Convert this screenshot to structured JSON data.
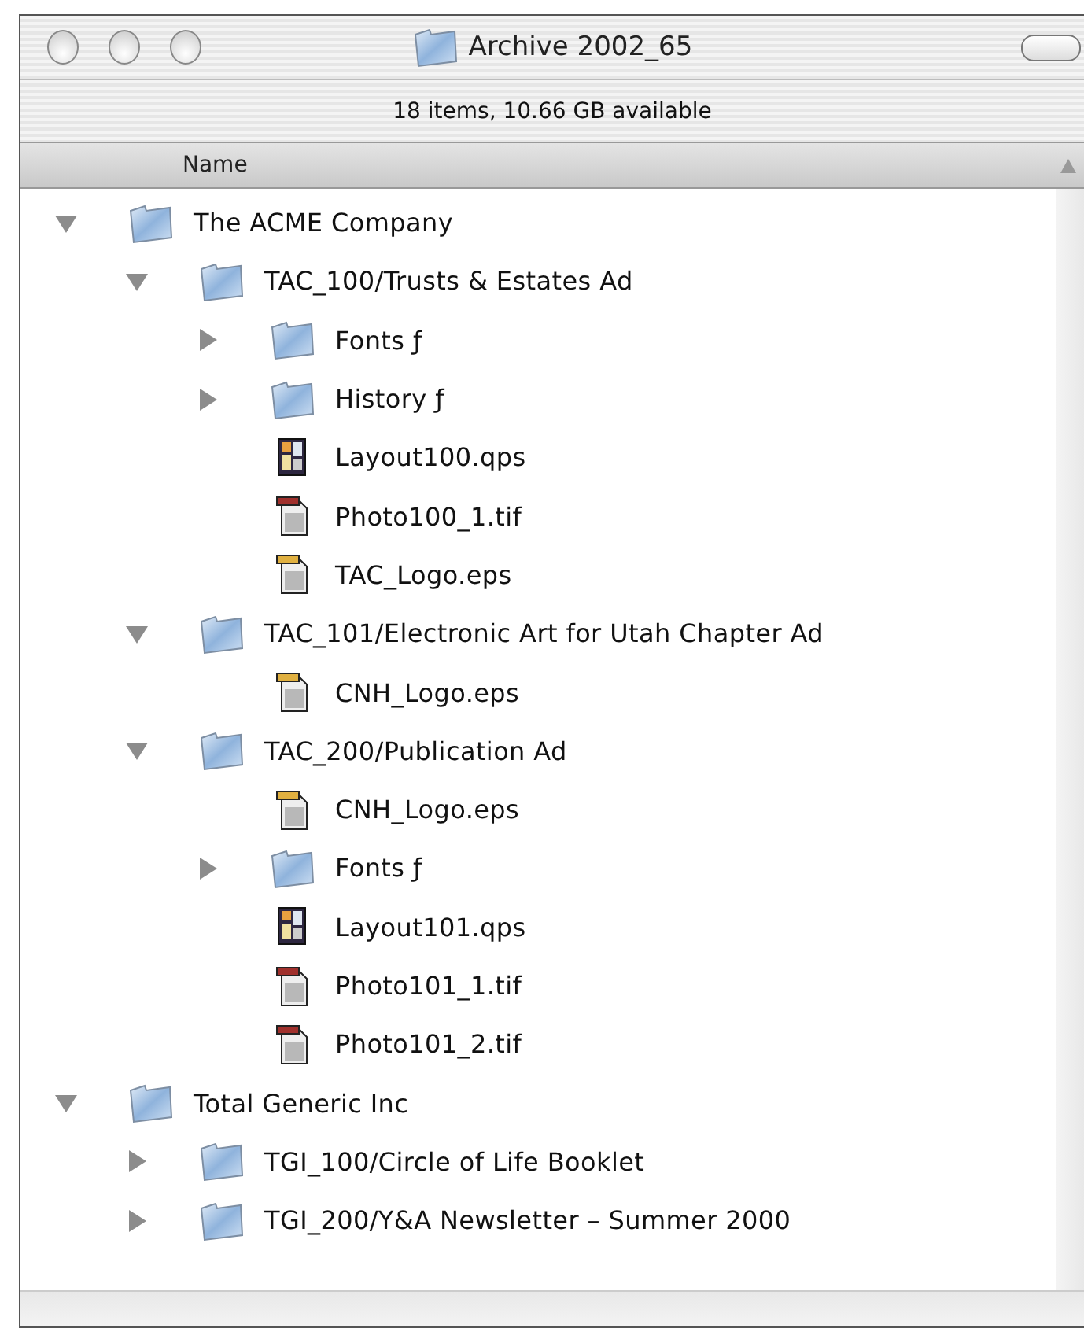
{
  "window": {
    "title": "Archive 2002_65",
    "status": "18 items, 10.66 GB available"
  },
  "columns": [
    {
      "label": "Name",
      "sorted": true
    }
  ],
  "items": [
    {
      "kind": "folder",
      "name": "The ACME Company",
      "expanded": true,
      "children": [
        {
          "kind": "folder",
          "name": "TAC_100/Trusts & Estates Ad",
          "expanded": true,
          "children": [
            {
              "kind": "folder",
              "name": "Fonts ƒ",
              "expanded": false
            },
            {
              "kind": "folder",
              "name": "History ƒ",
              "expanded": false
            },
            {
              "kind": "layout",
              "name": "Layout100.qps"
            },
            {
              "kind": "photo",
              "name": "Photo100_1.tif"
            },
            {
              "kind": "graphic",
              "name": "TAC_Logo.eps"
            }
          ]
        },
        {
          "kind": "folder",
          "name": "TAC_101/Electronic Art for Utah Chapter Ad",
          "expanded": true,
          "children": [
            {
              "kind": "graphic",
              "name": "CNH_Logo.eps"
            }
          ]
        },
        {
          "kind": "folder",
          "name": "TAC_200/Publication Ad",
          "expanded": true,
          "children": [
            {
              "kind": "graphic",
              "name": "CNH_Logo.eps"
            },
            {
              "kind": "folder",
              "name": "Fonts ƒ",
              "expanded": false
            },
            {
              "kind": "layout",
              "name": "Layout101.qps"
            },
            {
              "kind": "photo",
              "name": "Photo101_1.tif"
            },
            {
              "kind": "photo",
              "name": "Photo101_2.tif"
            }
          ]
        }
      ]
    },
    {
      "kind": "folder",
      "name": "Total Generic Inc",
      "expanded": true,
      "children": [
        {
          "kind": "folder",
          "name": "TGI_100/Circle of Life Booklet",
          "expanded": false
        },
        {
          "kind": "folder",
          "name": "TGI_200/Y&A Newsletter – Summer 2000",
          "expanded": false
        }
      ]
    }
  ]
}
